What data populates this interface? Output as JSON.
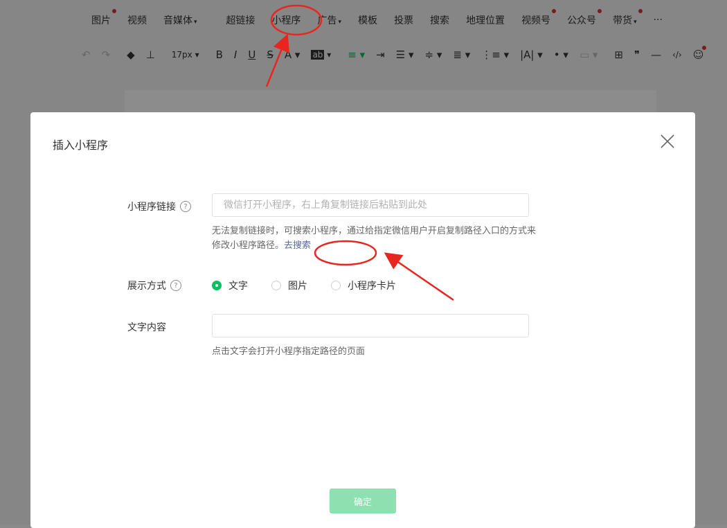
{
  "toolbar_top": {
    "items": [
      {
        "label": "图片",
        "dot": true,
        "caret": false
      },
      {
        "label": "视频",
        "dot": false,
        "caret": false
      },
      {
        "label": "音媒体",
        "dot": false,
        "caret": true
      },
      {
        "label": "超链接",
        "dot": false,
        "caret": false
      },
      {
        "label": "小程序",
        "dot": false,
        "caret": false
      },
      {
        "label": "广告",
        "dot": false,
        "caret": true
      },
      {
        "label": "模板",
        "dot": false,
        "caret": false
      },
      {
        "label": "投票",
        "dot": false,
        "caret": false
      },
      {
        "label": "搜索",
        "dot": false,
        "caret": false
      },
      {
        "label": "地理位置",
        "dot": false,
        "caret": false
      },
      {
        "label": "视频号",
        "dot": true,
        "caret": false
      },
      {
        "label": "公众号",
        "dot": true,
        "caret": false
      },
      {
        "label": "带货",
        "dot": true,
        "caret": true
      },
      {
        "label": "···",
        "dot": false,
        "caret": false
      }
    ]
  },
  "toolbar_fmt": {
    "undo": "↶",
    "redo": "↷",
    "font_size": "17px",
    "bold": "B",
    "italic": "I",
    "underline": "U",
    "strike": "S",
    "font_color": "A",
    "bg_color": "ab",
    "emoji_dot": true
  },
  "modal": {
    "title": "插入小程序",
    "link_label": "小程序链接",
    "link_placeholder": "微信打开小程序，右上角复制链接后粘贴到此处",
    "link_value": "",
    "hint_text": "无法复制链接时，可搜索小程序，通过给指定微信用户开启复制路径入口的方式来修改小程序路径。",
    "hint_link": "去搜索",
    "display_label": "展示方式",
    "radio_options": [
      {
        "label": "文字",
        "checked": true
      },
      {
        "label": "图片",
        "checked": false
      },
      {
        "label": "小程序卡片",
        "checked": false
      }
    ],
    "text_label": "文字内容",
    "text_value": "",
    "text_hint": "点击文字会打开小程序指定路径的页面",
    "confirm_label": "确定"
  },
  "colors": {
    "primary_green": "#07c160",
    "disabled_green": "#8ee0b0",
    "link_blue": "#576b95",
    "annotation_red": "#e8261f"
  }
}
